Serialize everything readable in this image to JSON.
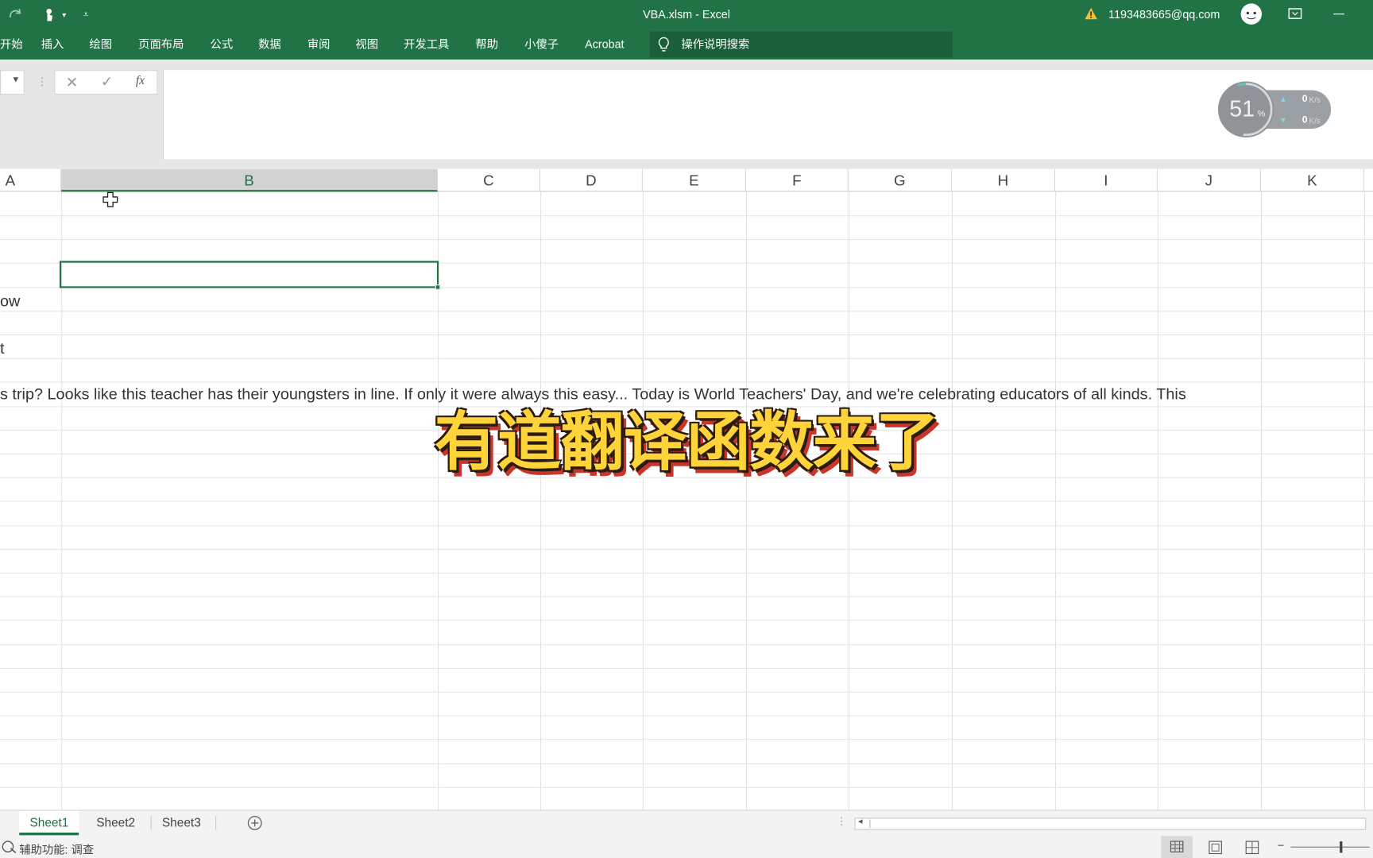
{
  "window": {
    "title": "VBA.xlsm  -  Excel",
    "user_email": "1193483665@qq.com"
  },
  "ribbon": {
    "tabs": [
      "开始",
      "插入",
      "绘图",
      "页面布局",
      "公式",
      "数据",
      "审阅",
      "视图",
      "开发工具",
      "帮助",
      "小傻子",
      "Acrobat"
    ],
    "tell_me": "操作说明搜索"
  },
  "formula_bar": {
    "fx_label": "fx",
    "value": ""
  },
  "network_widget": {
    "percent": "51",
    "unit": "%",
    "upload": "0",
    "download": "0",
    "speed_unit": "K/s"
  },
  "grid": {
    "columns": [
      "A",
      "B",
      "C",
      "D",
      "E",
      "F",
      "G",
      "H",
      "I",
      "J",
      "K"
    ],
    "selected_column": "B",
    "cells": {
      "row5_a": "ow",
      "row7_a": "t",
      "row9_a": "s trip? Looks like this teacher has their youngsters in line. If only it were always this easy... Today is World Teachers' Day, and we're celebrating educators of all kinds. This"
    }
  },
  "sheets": [
    "Sheet1",
    "Sheet2",
    "Sheet3"
  ],
  "active_sheet": "Sheet1",
  "status": {
    "accessibility": "辅助功能: 调查"
  },
  "overlay_caption": "有道翻译函数来了",
  "colors": {
    "excel_green": "#217346",
    "caption_fill": "#ffd43a",
    "caption_shadow": "#c9352b"
  }
}
